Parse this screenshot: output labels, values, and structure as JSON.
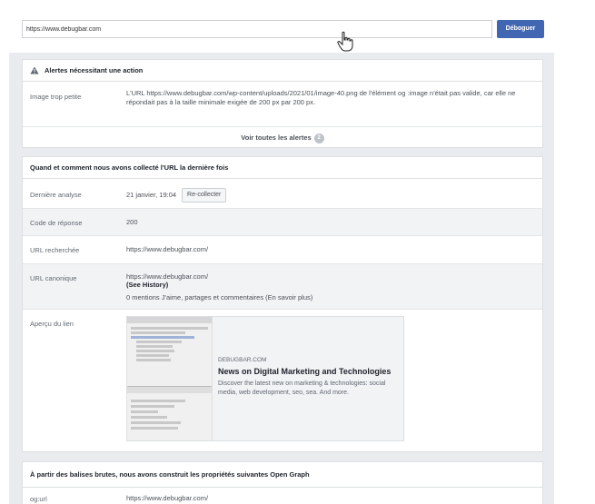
{
  "toolbar": {
    "url_value": "https://www.debugbar.com",
    "debug_label": "Déboguer"
  },
  "alerts": {
    "title": "Alertes nécessitant une action",
    "row_label": "Image trop petite",
    "row_text": "L'URL https://www.debugbar.com/wp-content/uploads/2021/01/image-40.png de l'élément og :image n'était pas valide, car elle ne répondait pas à la taille minimale exigée de 200 px par 200 px.",
    "see_all": "Voir toutes les alertes",
    "count": "2"
  },
  "scrape": {
    "title": "Quand et comment nous avons collecté l'URL la dernière fois",
    "last_label": "Dernière analyse",
    "last_value": "21 janvier, 19:04",
    "recollect": "Re-collecter",
    "code_label": "Code de réponse",
    "code_value": "200",
    "fetched_label": "URL recherchée",
    "fetched_value": "https://www.debugbar.com/",
    "canon_label": "URL canonique",
    "canon_value": "https://www.debugbar.com/",
    "history": "(See History)",
    "mentions": "0 mentions J'aime, partages et commentaires (En savoir plus)",
    "preview_label": "Aperçu du lien"
  },
  "preview": {
    "domain": "DEBUGBAR.COM",
    "title": "News on Digital Marketing and Technologies",
    "description": "Discover the latest new on marketing & technologies: social media, web development, seo, sea. And more."
  },
  "og": {
    "title": "À partir des balises brutes, nous avons construit les propriétés suivantes Open Graph",
    "first_label": "og:url",
    "first_value": "https://www.debugbar.com/"
  }
}
